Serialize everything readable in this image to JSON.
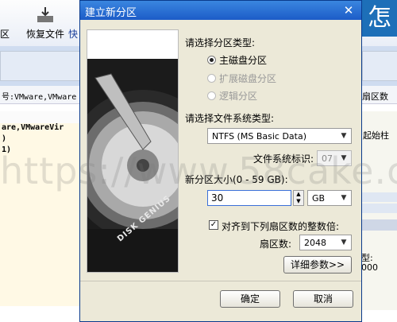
{
  "background": {
    "toolbar": {
      "partition_label": "区",
      "recover_label": "恢复文件",
      "more_label": "快",
      "brand_char": "怎"
    },
    "info_row_text": "号:VMware,VMware",
    "info_row_right": "扇区数",
    "info_line1": "are,VMwareVir",
    "info_line2": ")",
    "info_line3": "1)",
    "right_col_label": "起始柱",
    "right_col_v1": "型:",
    "right_col_v2": "000"
  },
  "dialog": {
    "title": "建立新分区",
    "close_glyph": "✕",
    "image_text": "DISK GENIUS",
    "partition_type_label": "请选择分区类型:",
    "partition_types": [
      {
        "label": "主磁盘分区",
        "selected": true,
        "enabled": true
      },
      {
        "label": "扩展磁盘分区",
        "selected": false,
        "enabled": false
      },
      {
        "label": "逻辑分区",
        "selected": false,
        "enabled": false
      }
    ],
    "fs_type_label": "请选择文件系统类型:",
    "fs_type_value": "NTFS (MS Basic Data)",
    "fs_id_label": "文件系统标识:",
    "fs_id_value": "07",
    "size_label": "新分区大小(0 - 59 GB):",
    "size_value": "30",
    "size_unit": "GB",
    "align_label": "对齐到下列扇区数的整数倍:",
    "align_checked": true,
    "check_glyph": "✓",
    "sector_label": "扇区数:",
    "sector_value": "2048",
    "advanced_button": "详细参数>>",
    "ok_button": "确定",
    "cancel_button": "取消"
  },
  "watermark": "https://www.58cake.com",
  "icons": {
    "dropdown": "▼",
    "spin_up": "▲",
    "spin_down": "▼"
  }
}
